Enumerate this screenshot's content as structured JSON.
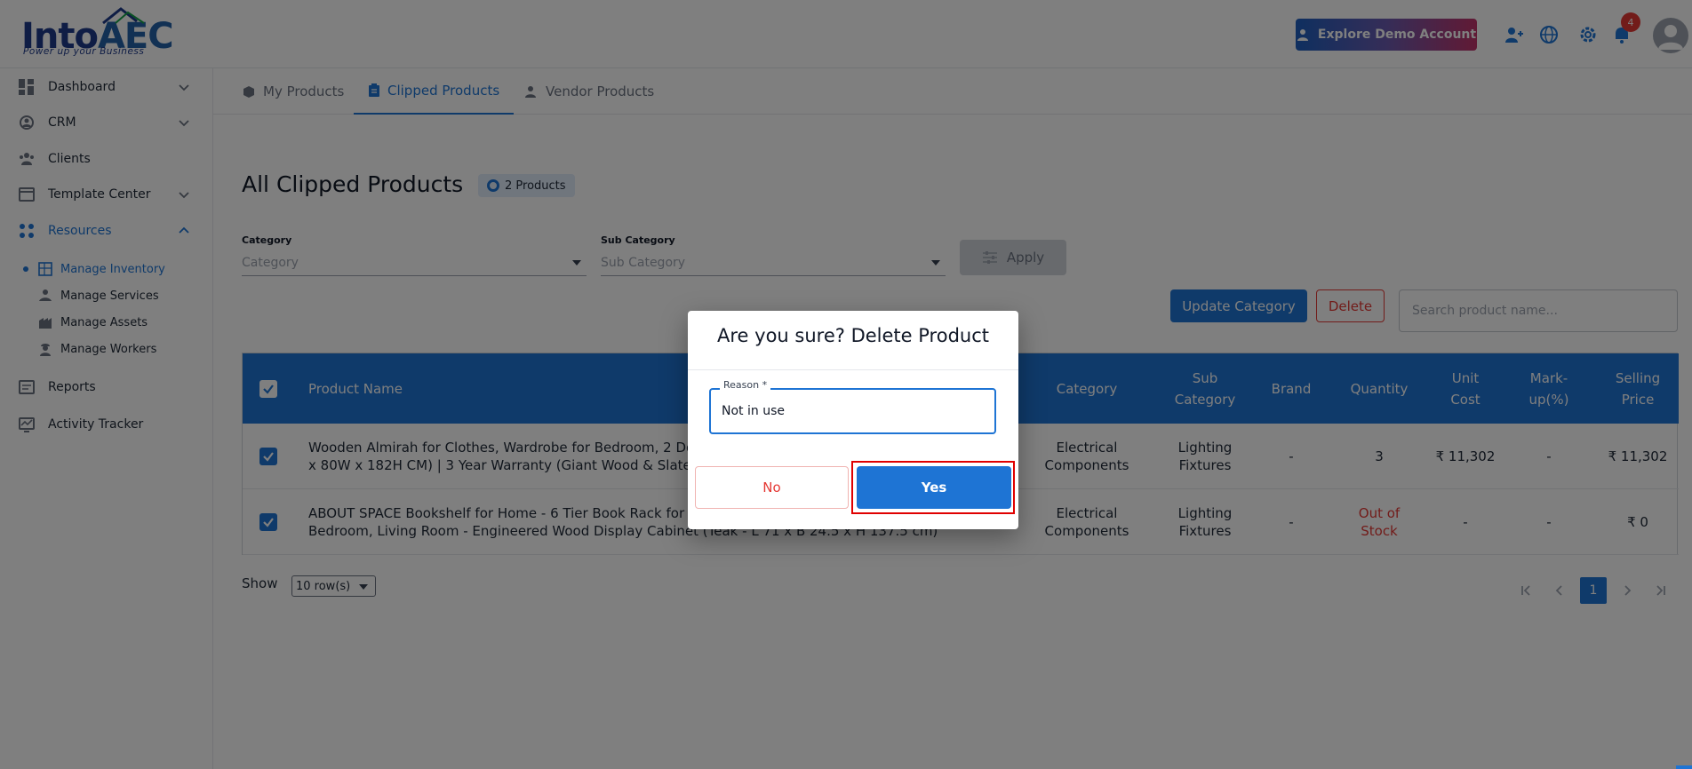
{
  "brand": {
    "name_main": "Into",
    "name_accent": "AEC",
    "tagline": "Power up your Business",
    "accent_color": "#1e74d4"
  },
  "header": {
    "demo_label": "Explore Demo Account",
    "notification_count": "4"
  },
  "sidebar": {
    "items": [
      {
        "label": "Dashboard",
        "icon": "dashboard-icon"
      },
      {
        "label": "CRM",
        "icon": "crm-icon"
      },
      {
        "label": "Clients",
        "icon": "clients-icon"
      },
      {
        "label": "Template Center",
        "icon": "template-icon"
      },
      {
        "label": "Resources",
        "icon": "resources-icon"
      },
      {
        "label": "Reports",
        "icon": "reports-icon"
      },
      {
        "label": "Activity Tracker",
        "icon": "activity-icon"
      }
    ],
    "sub_items": [
      {
        "label": "Manage Inventory",
        "icon": "inventory-icon"
      },
      {
        "label": "Manage Services",
        "icon": "services-icon"
      },
      {
        "label": "Manage Assets",
        "icon": "assets-icon"
      },
      {
        "label": "Manage Workers",
        "icon": "workers-icon"
      }
    ]
  },
  "tabs": [
    {
      "label": "My Products"
    },
    {
      "label": "Clipped Products"
    },
    {
      "label": "Vendor Products"
    }
  ],
  "page": {
    "title": "All Clipped Products",
    "count_badge": "2 Products"
  },
  "filters": {
    "category_label": "Category",
    "category_placeholder": "Category",
    "subcategory_label": "Sub Category",
    "subcategory_placeholder": "Sub Category",
    "apply_label": "Apply"
  },
  "actions": {
    "update_category": "Update Category",
    "delete": "Delete",
    "search_placeholder": "Search product name..."
  },
  "table": {
    "headers": {
      "product_name": "Product Name",
      "category": "Category",
      "sub_category_1": "Sub",
      "sub_category_2": "Category",
      "brand": "Brand",
      "quantity": "Quantity",
      "unit_cost_1": "Unit",
      "unit_cost_2": "Cost",
      "markup_1": "Mark-",
      "markup_2": "up(%)",
      "selling_1": "Selling",
      "selling_2": "Price"
    },
    "rows": [
      {
        "name_1": "Wooden Almirah for Clothes, Wardrobe for Bedroom, 2 Door W",
        "name_2": "x 80W x 182H CM) | 3 Year Warranty (Giant Wood & Slate Grey)",
        "category_1": "Electrical",
        "category_2": "Components",
        "sub_category_1": "Lighting",
        "sub_category_2": "Fixtures",
        "brand": "-",
        "quantity": "3",
        "unit_cost": "₹ 11,302",
        "markup": "-",
        "selling_price": "₹ 11,302"
      },
      {
        "name_1": "ABOUT SPACE Bookshelf for Home - 6 Tier Book Rack for Study",
        "name_2": "Bedroom, Living Room - Engineered Wood Display Cabinet (Teak - L 71 x B 24.5 x H 137.5 cm)",
        "category_1": "Electrical",
        "category_2": "Components",
        "sub_category_1": "Lighting",
        "sub_category_2": "Fixtures",
        "brand": "-",
        "quantity_1": "Out of",
        "quantity_2": "Stock",
        "unit_cost": "-",
        "markup": "-",
        "selling_price": "₹ 0"
      }
    ]
  },
  "pagination": {
    "show_label": "Show",
    "rows_per_page": "10 row(s)",
    "current_page": "1"
  },
  "dialog": {
    "title": "Are you sure? Delete Product",
    "reason_label": "Reason *",
    "reason_value": "Not in use",
    "no_label": "No",
    "yes_label": "Yes"
  }
}
